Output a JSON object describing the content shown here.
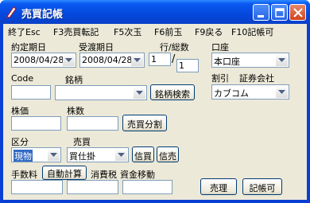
{
  "window": {
    "title": "売買記帳"
  },
  "menu": [
    {
      "label": "終了Esc"
    },
    {
      "label": "F3売買転記"
    },
    {
      "label": "F5次玉"
    },
    {
      "label": "F6前玉"
    },
    {
      "label": "F9戻る"
    },
    {
      "label": "F10記帳可"
    }
  ],
  "form": {
    "contract_date": {
      "label": "約定期日",
      "value": "2008/04/28"
    },
    "delivery_date": {
      "label": "受渡期日",
      "value": "2008/04/28"
    },
    "row_total": {
      "label": "行/総数",
      "row": "1",
      "total": "1"
    },
    "account": {
      "label": "口座",
      "value": "本口座"
    },
    "code": {
      "label": "Code",
      "value": ""
    },
    "brand": {
      "label": "銘柄",
      "value": ""
    },
    "brand_search_button": "銘柄検索",
    "discount": {
      "label": "割引"
    },
    "securities_company": {
      "label": "証券会社",
      "value": "カブコム"
    },
    "price": {
      "label": "株価",
      "value": ""
    },
    "shares": {
      "label": "株数",
      "value": ""
    },
    "split_button": "売買分割",
    "category": {
      "label": "区分",
      "value": "現物"
    },
    "trade": {
      "label": "売買",
      "value": "買仕掛"
    },
    "margin_buy_button": "信買",
    "margin_sell_button": "信売",
    "fee": {
      "label": "手数料",
      "value": ""
    },
    "auto_calc_button": "自動計算",
    "consumption_tax": {
      "label": "消費税",
      "value": ""
    },
    "fund_transfer": {
      "label": "資金移動",
      "value": ""
    },
    "sell_button": "売理",
    "record_button": "記帳可"
  },
  "colors": {
    "title_bar": "#0548dc",
    "selection": "#316ac5",
    "face": "#ece9d8"
  }
}
